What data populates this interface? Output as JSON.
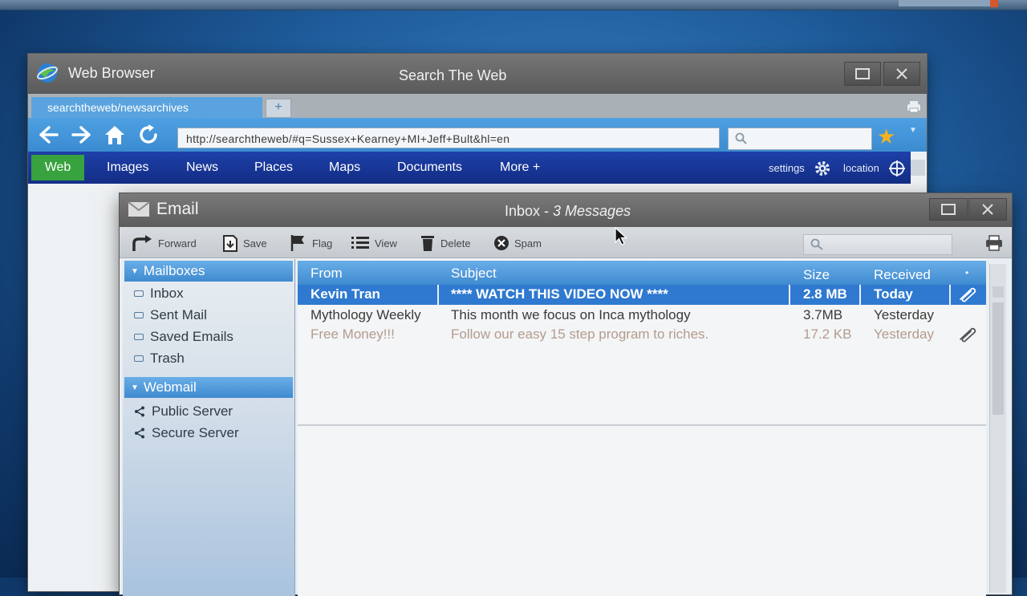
{
  "browser": {
    "app_name": "Web Browser",
    "window_title": "Search The Web",
    "tab_label": "searchtheweb/newsarchives",
    "new_tab": "+",
    "url": "http://searchtheweb/#q=Sussex+Kearney+MI+Jeff+Bult&hl=en",
    "links": [
      "Web",
      "Images",
      "News",
      "Places",
      "Maps",
      "Documents",
      "More +"
    ],
    "settings_label": "settings",
    "location_label": "location"
  },
  "email": {
    "app_name": "Email",
    "window_title_prefix": "Inbox - ",
    "window_title_count": "3 Messages",
    "toolbar": {
      "forward": "Forward",
      "save": "Save",
      "flag": "Flag",
      "view": "View",
      "delete": "Delete",
      "spam": "Spam"
    },
    "sidebar": {
      "mailboxes_header": "Mailboxes",
      "mailboxes": [
        "Inbox",
        "Sent Mail",
        "Saved Emails",
        "Trash"
      ],
      "webmail_header": "Webmail",
      "servers": [
        "Public Server",
        "Secure Server"
      ]
    },
    "columns": {
      "from": "From",
      "subject": "Subject",
      "size": "Size",
      "received": "Received",
      "attachment": "•"
    },
    "messages": [
      {
        "from": "Kevin Tran",
        "subject": "**** WATCH THIS VIDEO NOW ****",
        "size": "2.8 MB",
        "received": "Today",
        "attachment": true
      },
      {
        "from": "Mythology Weekly",
        "subject": "This month we focus on Inca mythology",
        "size": "3.7MB",
        "received": "Yesterday",
        "attachment": false
      },
      {
        "from": "Free Money!!!",
        "subject": "Follow our easy 15 step program to riches.",
        "size": "17.2 KB",
        "received": "Yesterday",
        "attachment": true
      }
    ]
  }
}
